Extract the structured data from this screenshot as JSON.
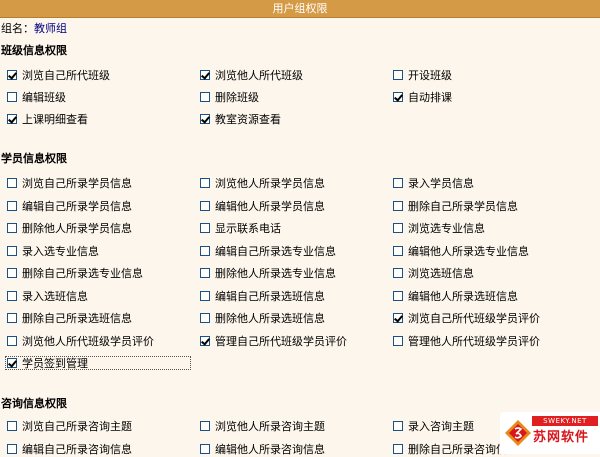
{
  "window": {
    "title": "用户组权限"
  },
  "group": {
    "label": "组名：",
    "value": "教师组"
  },
  "sections": {
    "class": {
      "title": "班级信息权限",
      "items": [
        {
          "label": "浏览自己所代班级",
          "checked": true
        },
        {
          "label": "浏览他人所代班级",
          "checked": true
        },
        {
          "label": "开设班级",
          "checked": false
        },
        {
          "label": "编辑班级",
          "checked": false
        },
        {
          "label": "删除班级",
          "checked": false
        },
        {
          "label": "自动排课",
          "checked": true
        },
        {
          "label": "上课明细查看",
          "checked": true
        },
        {
          "label": "教室资源查看",
          "checked": true
        }
      ]
    },
    "student": {
      "title": "学员信息权限",
      "items": [
        {
          "label": "浏览自己所录学员信息",
          "checked": false
        },
        {
          "label": "浏览他人所录学员信息",
          "checked": false
        },
        {
          "label": "录入学员信息",
          "checked": false
        },
        {
          "label": "编辑自己所录学员信息",
          "checked": false
        },
        {
          "label": "编辑他人所录学员信息",
          "checked": false
        },
        {
          "label": "删除自己所录学员信息",
          "checked": false
        },
        {
          "label": "删除他人所录学员信息",
          "checked": false
        },
        {
          "label": "显示联系电话",
          "checked": false
        },
        {
          "label": "浏览选专业信息",
          "checked": false
        },
        {
          "label": "录入选专业信息",
          "checked": false
        },
        {
          "label": "编辑自己所录选专业信息",
          "checked": false
        },
        {
          "label": "编辑他人所录选专业信息",
          "checked": false
        },
        {
          "label": "删除自己所录选专业信息",
          "checked": false
        },
        {
          "label": "删除他人所录选专业信息",
          "checked": false
        },
        {
          "label": "浏览选班信息",
          "checked": false
        },
        {
          "label": "录入选班信息",
          "checked": false
        },
        {
          "label": "编辑自己所录选班信息",
          "checked": false
        },
        {
          "label": "编辑他人所录选班信息",
          "checked": false
        },
        {
          "label": "删除自己所录选班信息",
          "checked": false
        },
        {
          "label": "删除他人所录选班信息",
          "checked": false
        },
        {
          "label": "浏览自己所代班级学员评价",
          "checked": true
        },
        {
          "label": "浏览他人所代班级学员评价",
          "checked": false
        },
        {
          "label": "管理自己所代班级学员评价",
          "checked": true
        },
        {
          "label": "管理他人所代班级学员评价",
          "checked": false
        },
        {
          "label": "学员签到管理",
          "checked": true
        }
      ]
    },
    "consult": {
      "title": "咨询信息权限",
      "items": [
        {
          "label": "浏览自己所录咨询主题",
          "checked": false
        },
        {
          "label": "浏览他人所录咨询主题",
          "checked": false
        },
        {
          "label": "录入咨询主题",
          "checked": false
        },
        {
          "label": "编辑自己所录咨询信息",
          "checked": false
        },
        {
          "label": "编辑他人所录咨询信息",
          "checked": false
        },
        {
          "label": "删除自己所录咨询信息",
          "checked": false
        }
      ]
    }
  },
  "watermark": {
    "url": "SWEKY.NET",
    "name": "苏网软件"
  }
}
